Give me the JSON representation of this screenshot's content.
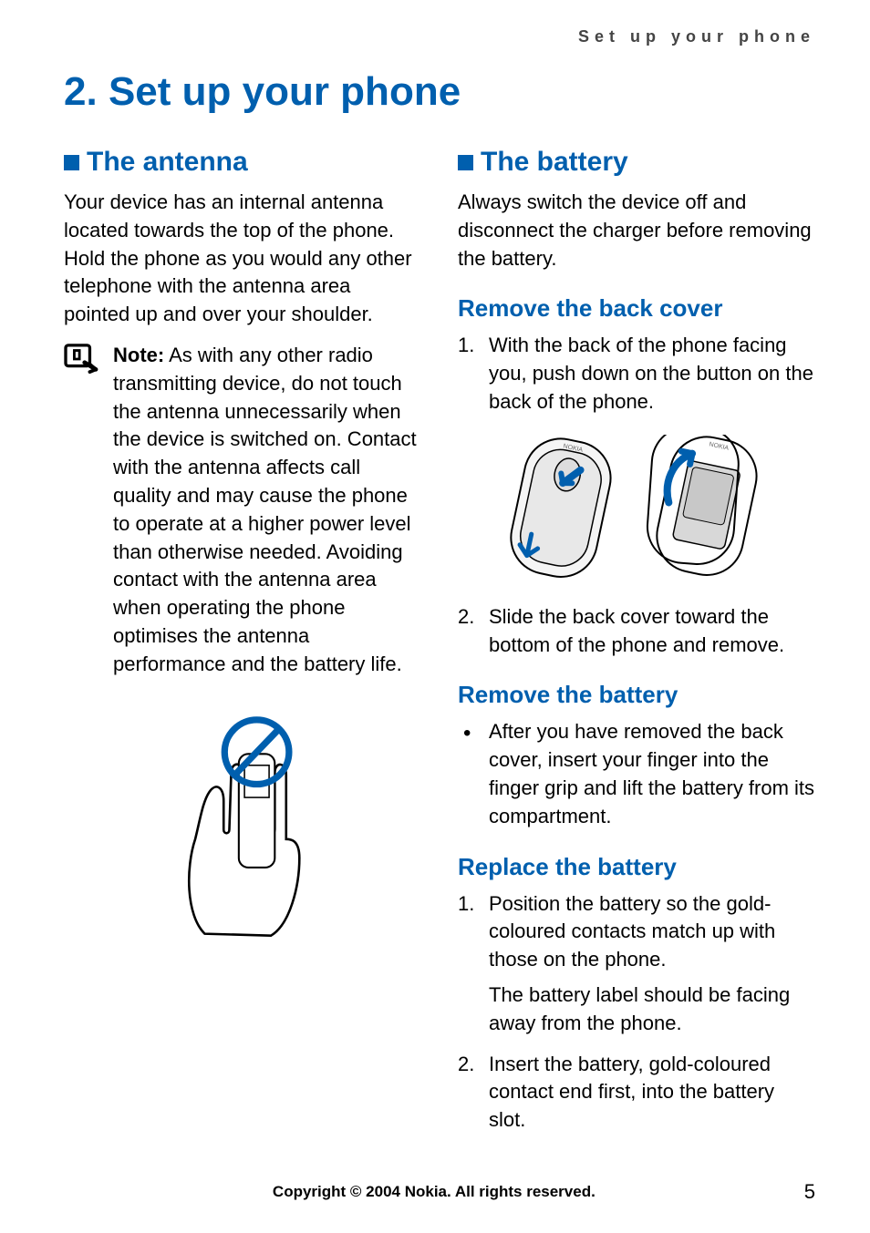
{
  "header": {
    "running_head": "Set up your phone"
  },
  "chapter": {
    "number": "2.",
    "title": "Set up your phone"
  },
  "left": {
    "heading": "The antenna",
    "para": "Your device has an internal antenna located towards the top of the phone. Hold the phone as you would any other telephone with the antenna area pointed up and over your shoulder.",
    "note_label": "Note:",
    "note_text": "As with any other radio transmitting device, do not touch the antenna unnecessarily when the device is switched on. Contact with the antenna affects call quality and may cause the phone to operate at a higher power level than otherwise needed. Avoiding contact with the antenna area when operating the phone optimises the antenna performance and the battery life."
  },
  "right": {
    "heading": "The battery",
    "intro": "Always switch the device off and disconnect the charger before removing the battery.",
    "remove_cover": {
      "heading": "Remove the back cover",
      "step1": "With the back of the phone facing you, push down on the button on the back of the phone.",
      "step2": "Slide the back cover toward the bottom of the phone and remove."
    },
    "remove_battery": {
      "heading": "Remove the battery",
      "bullet": "After you have removed the back cover, insert your finger into the finger grip and lift the battery from its compartment."
    },
    "replace_battery": {
      "heading": "Replace the battery",
      "step1": "Position the battery so the gold-coloured contacts match up with those on the phone.",
      "step1b": "The battery label should be facing away from the phone.",
      "step2": "Insert the battery, gold-coloured contact end first, into the battery slot."
    }
  },
  "footer": {
    "copyright": "Copyright © 2004 Nokia. All rights reserved.",
    "page": "5"
  }
}
